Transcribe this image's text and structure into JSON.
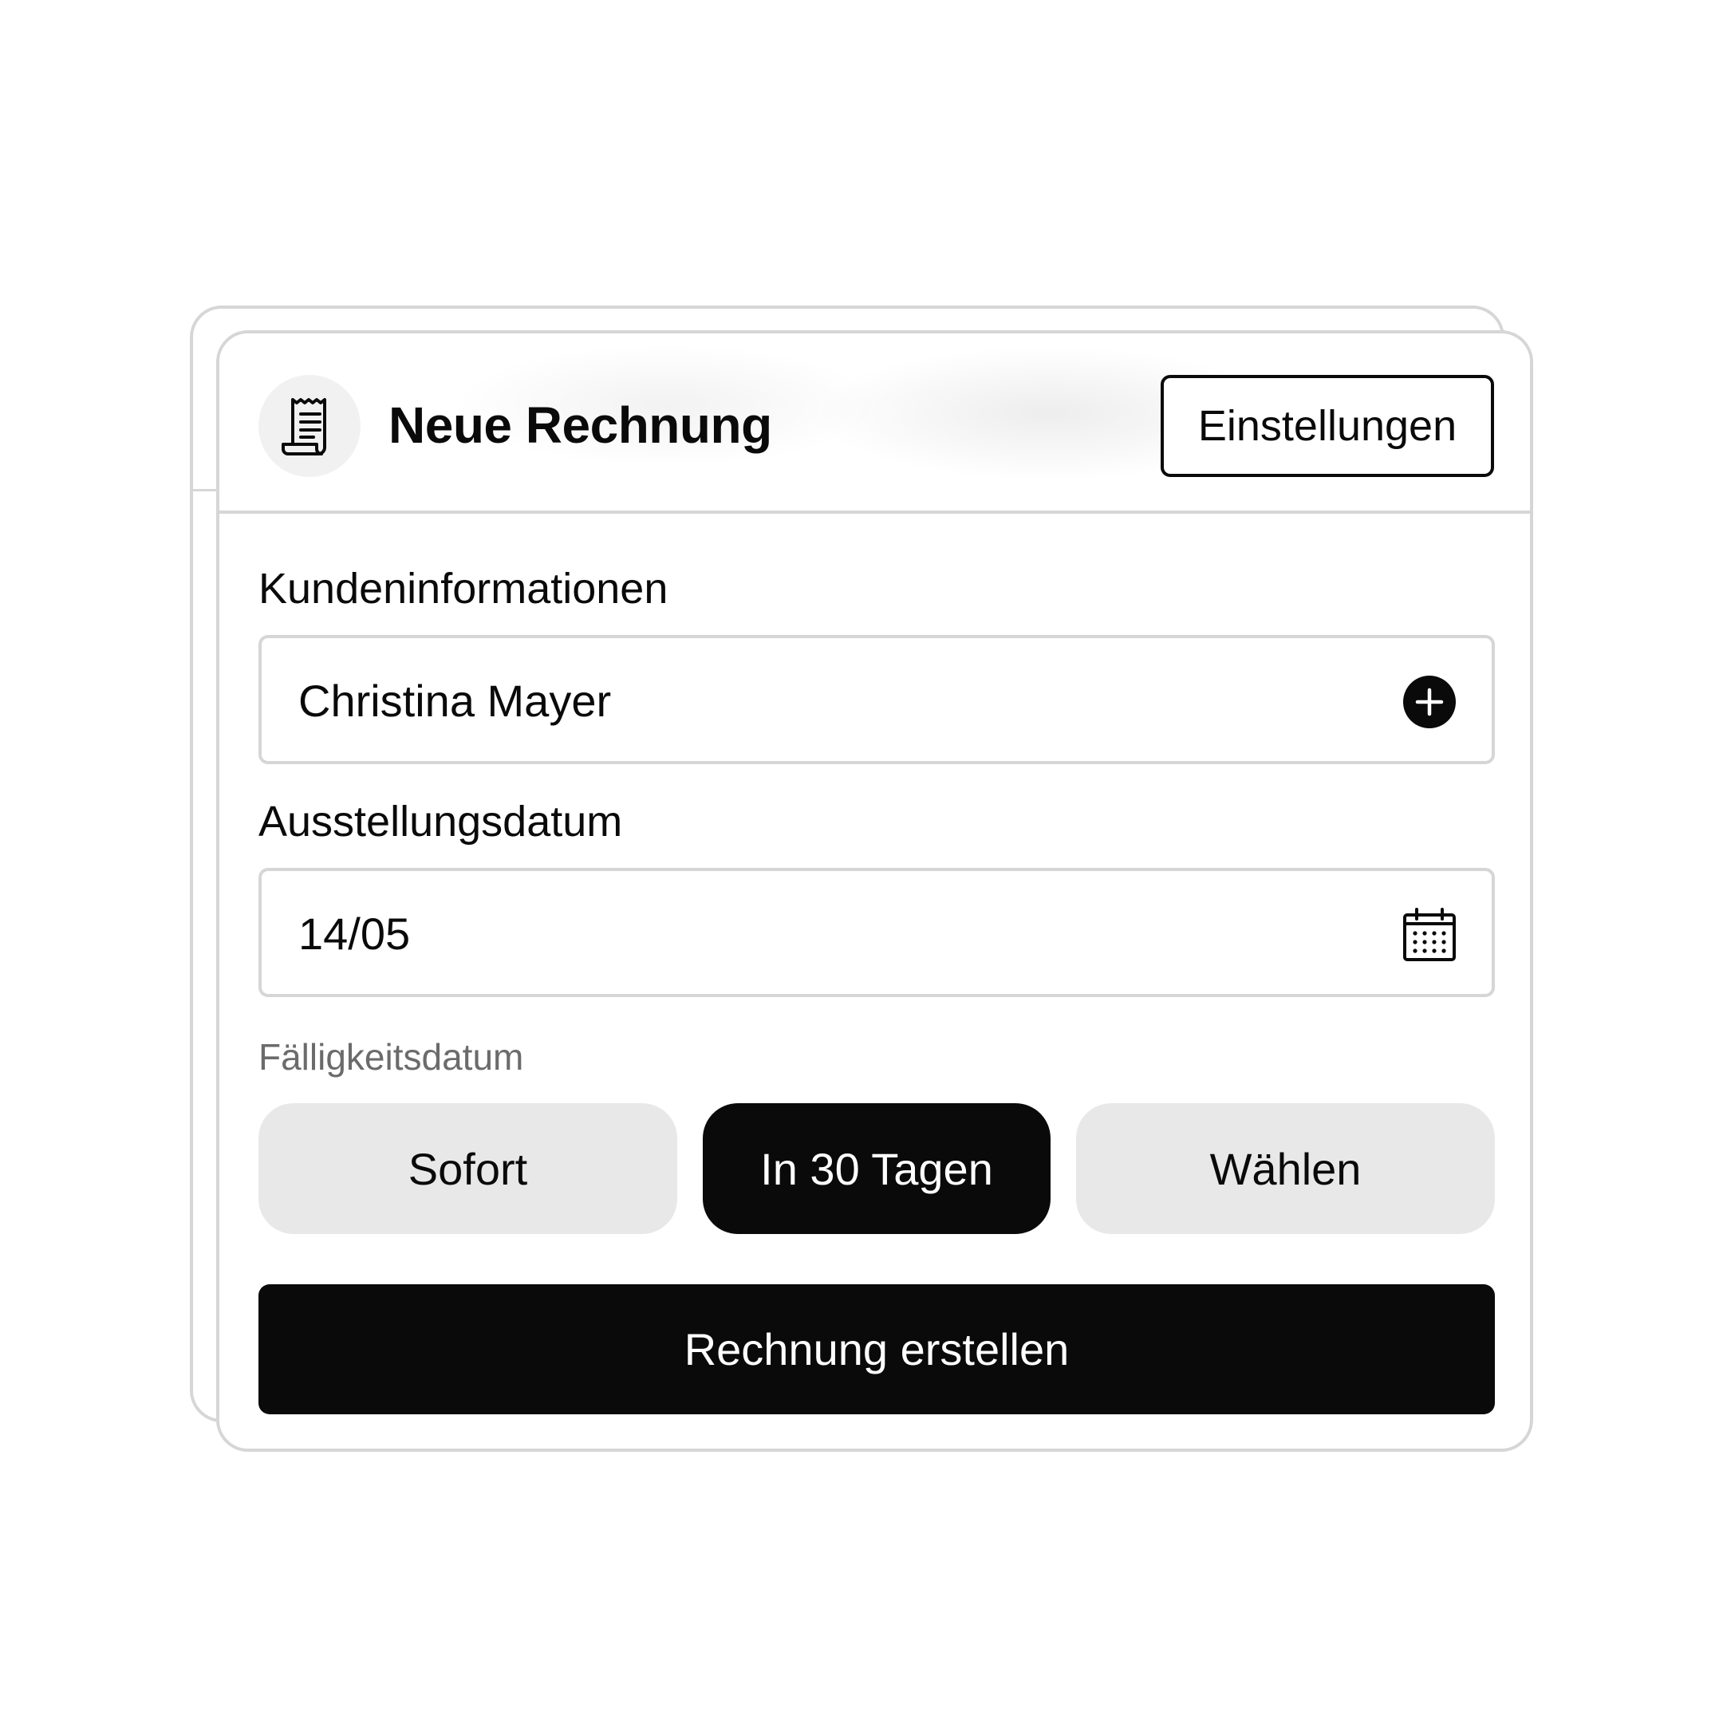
{
  "header": {
    "title": "Neue Rechnung",
    "icon": "receipt-icon",
    "settings_label": "Einstellungen"
  },
  "customer": {
    "label": "Kundeninformationen",
    "value": "Christina Mayer",
    "action_icon": "plus-circle-icon"
  },
  "issue_date": {
    "label": "Ausstellungsdatum",
    "value": "14/05",
    "icon": "calendar-icon"
  },
  "due_date": {
    "label": "Fälligkeitsdatum",
    "options": [
      {
        "label": "Sofort",
        "selected": false
      },
      {
        "label": "In 30 Tagen",
        "selected": true
      },
      {
        "label": "Wählen",
        "selected": false
      }
    ]
  },
  "submit": {
    "label": "Rechnung erstellen"
  },
  "colors": {
    "primary": "#0a0a0a",
    "border": "#d6d6d6",
    "chip_background": "#e8e8e8",
    "muted_text": "#6b6b6b"
  }
}
